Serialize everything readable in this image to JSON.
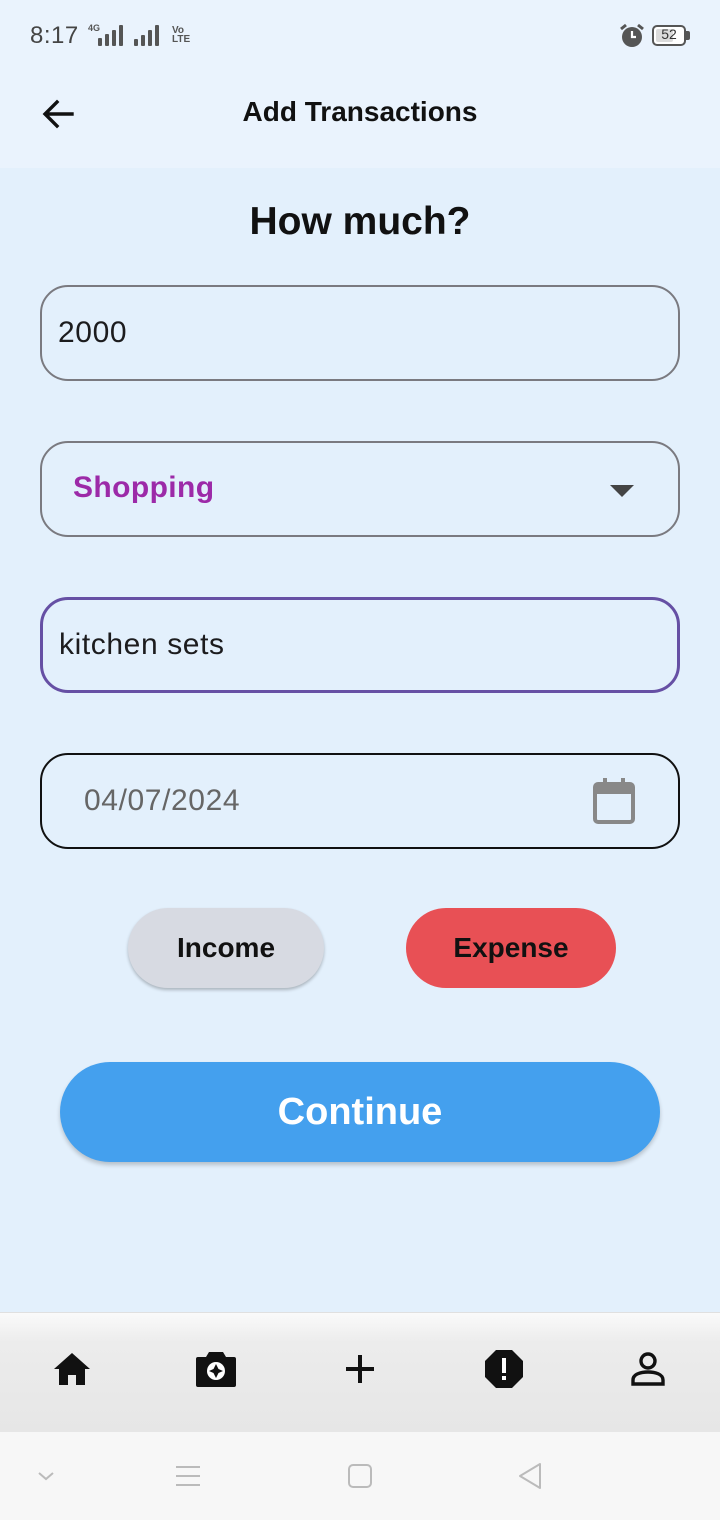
{
  "status_bar": {
    "time": "8:17",
    "network_1": "4G",
    "network_2": "Vo LTE",
    "battery": "52"
  },
  "app_bar": {
    "title": "Add Transactions",
    "back_icon": "arrow-left-icon"
  },
  "form": {
    "heading": "How much?",
    "amount": "2000",
    "category": "Shopping",
    "description": "kitchen sets",
    "date": "04/07/2024",
    "income_label": "Income",
    "expense_label": "Expense",
    "continue_label": "Continue"
  },
  "bottom_nav": {
    "items": [
      "home-icon",
      "camera-icon",
      "add-icon",
      "alert-icon",
      "profile-icon"
    ]
  },
  "colors": {
    "primary": "#44a0ee",
    "expense": "#e85055",
    "income": "#d7dae2",
    "category_text": "#9c2aa8",
    "focus_border": "#6650a4"
  }
}
